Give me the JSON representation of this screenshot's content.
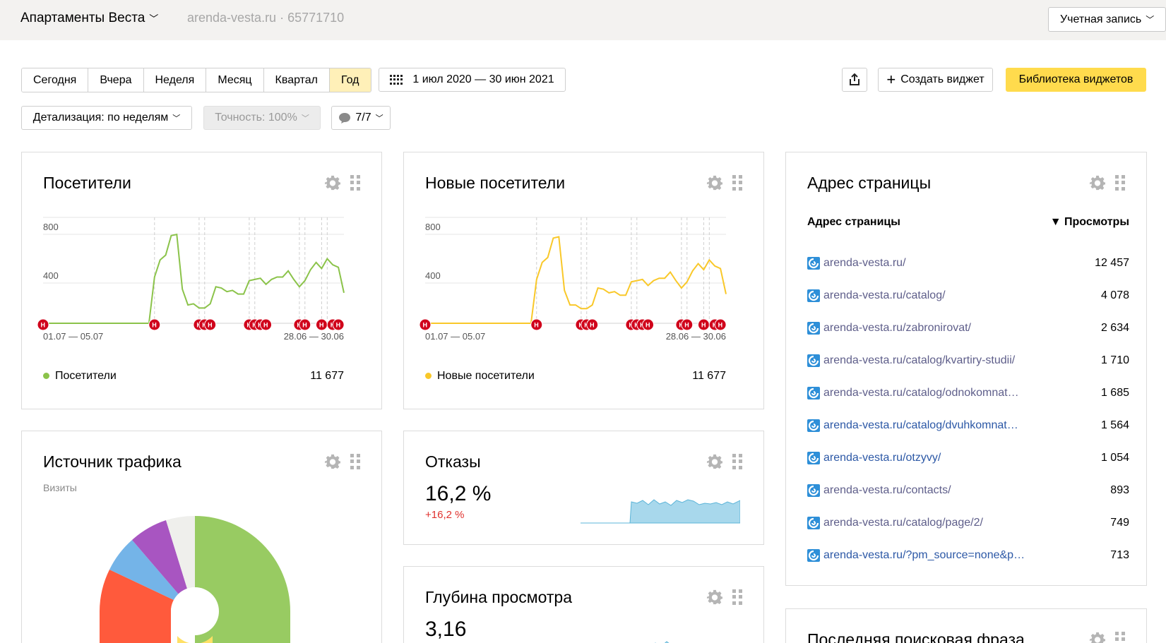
{
  "header": {
    "site_name": "Апартаменты Веста",
    "site_meta": "arenda-vesta.ru · 65771710",
    "account": "Учетная запись"
  },
  "toolbar": {
    "periods": [
      {
        "label": "Сегодня",
        "active": false
      },
      {
        "label": "Вчера",
        "active": false
      },
      {
        "label": "Неделя",
        "active": false
      },
      {
        "label": "Месяц",
        "active": false
      },
      {
        "label": "Квартал",
        "active": false
      },
      {
        "label": "Год",
        "active": true
      }
    ],
    "date_range": "1 июл 2020 — 30 июн 2021",
    "create_widget": "Создать виджет",
    "widget_library": "Библиотека виджетов",
    "detail": "Детализация: по неделям",
    "accuracy": "Точность: 100%",
    "notes": "7/7"
  },
  "visitors": {
    "title": "Посетители",
    "y_ticks": [
      "800",
      "400"
    ],
    "x_start": "01.07 — 05.07",
    "x_end": "28.06 — 30.06",
    "legend": "Посетители",
    "total": "11 677",
    "color": "#8bc34a"
  },
  "new_visitors": {
    "title": "Новые посетители",
    "y_ticks": [
      "800",
      "400"
    ],
    "x_start": "01.07 — 05.07",
    "x_end": "28.06 — 30.06",
    "legend": "Новые посетители",
    "total": "11 677",
    "color": "#f9c829"
  },
  "chart_data": [
    {
      "type": "line",
      "series": [
        {
          "name": "Посетители",
          "values": [
            0,
            0,
            0,
            0,
            0,
            0,
            0,
            0,
            0,
            0,
            0,
            0,
            0,
            0,
            0,
            0,
            0,
            0,
            0,
            0,
            380,
            520,
            560,
            720,
            730,
            280,
            150,
            160,
            125,
            125,
            160,
            300,
            290,
            260,
            270,
            240,
            240,
            350,
            360,
            370,
            320,
            360,
            380,
            380,
            430,
            360,
            300,
            350,
            440,
            500,
            450,
            530,
            480,
            460,
            250
          ]
        }
      ],
      "ylim": [
        0,
        800
      ],
      "note_marker_label": "Н"
    },
    {
      "type": "line",
      "series": [
        {
          "name": "Новые посетители",
          "values": [
            0,
            0,
            0,
            0,
            0,
            0,
            0,
            0,
            0,
            0,
            0,
            0,
            0,
            0,
            0,
            0,
            0,
            0,
            0,
            0,
            360,
            500,
            540,
            700,
            710,
            270,
            150,
            150,
            120,
            120,
            150,
            290,
            280,
            250,
            260,
            230,
            230,
            340,
            350,
            360,
            310,
            350,
            370,
            370,
            420,
            350,
            290,
            340,
            430,
            490,
            440,
            520,
            470,
            450,
            240
          ]
        }
      ],
      "ylim": [
        0,
        800
      ],
      "note_marker_label": "Н"
    }
  ],
  "pages": {
    "title": "Адрес страницы",
    "col_page": "Адрес страницы",
    "col_views": "▼ Просмотры",
    "rows": [
      {
        "url": "arenda-vesta.ru/",
        "views": "12 457"
      },
      {
        "url": "arenda-vesta.ru/catalog/",
        "views": "4 078"
      },
      {
        "url": "arenda-vesta.ru/zabronirovat/",
        "views": "2 634"
      },
      {
        "url": "arenda-vesta.ru/catalog/kvartiry-studii/",
        "views": "1 710"
      },
      {
        "url": "arenda-vesta.ru/catalog/odnokomnat…",
        "views": "1 685"
      },
      {
        "url": "arenda-vesta.ru/catalog/dvuhkomnat…",
        "views": "1 564"
      },
      {
        "url": "arenda-vesta.ru/otzyvy/",
        "views": "1 054"
      },
      {
        "url": "arenda-vesta.ru/contacts/",
        "views": "893"
      },
      {
        "url": "arenda-vesta.ru/catalog/page/2/",
        "views": "749"
      },
      {
        "url": "arenda-vesta.ru/?pm_source=none&p…",
        "views": "713"
      }
    ]
  },
  "traffic": {
    "title": "Источник трафика",
    "subtitle": "Визиты"
  },
  "bounces": {
    "title": "Отказы",
    "value": "16,2 %",
    "delta": "+16,2 %"
  },
  "depth": {
    "title": "Глубина просмотра",
    "value": "3,16"
  },
  "last_phrase": {
    "title": "Последняя поисковая фраза"
  }
}
